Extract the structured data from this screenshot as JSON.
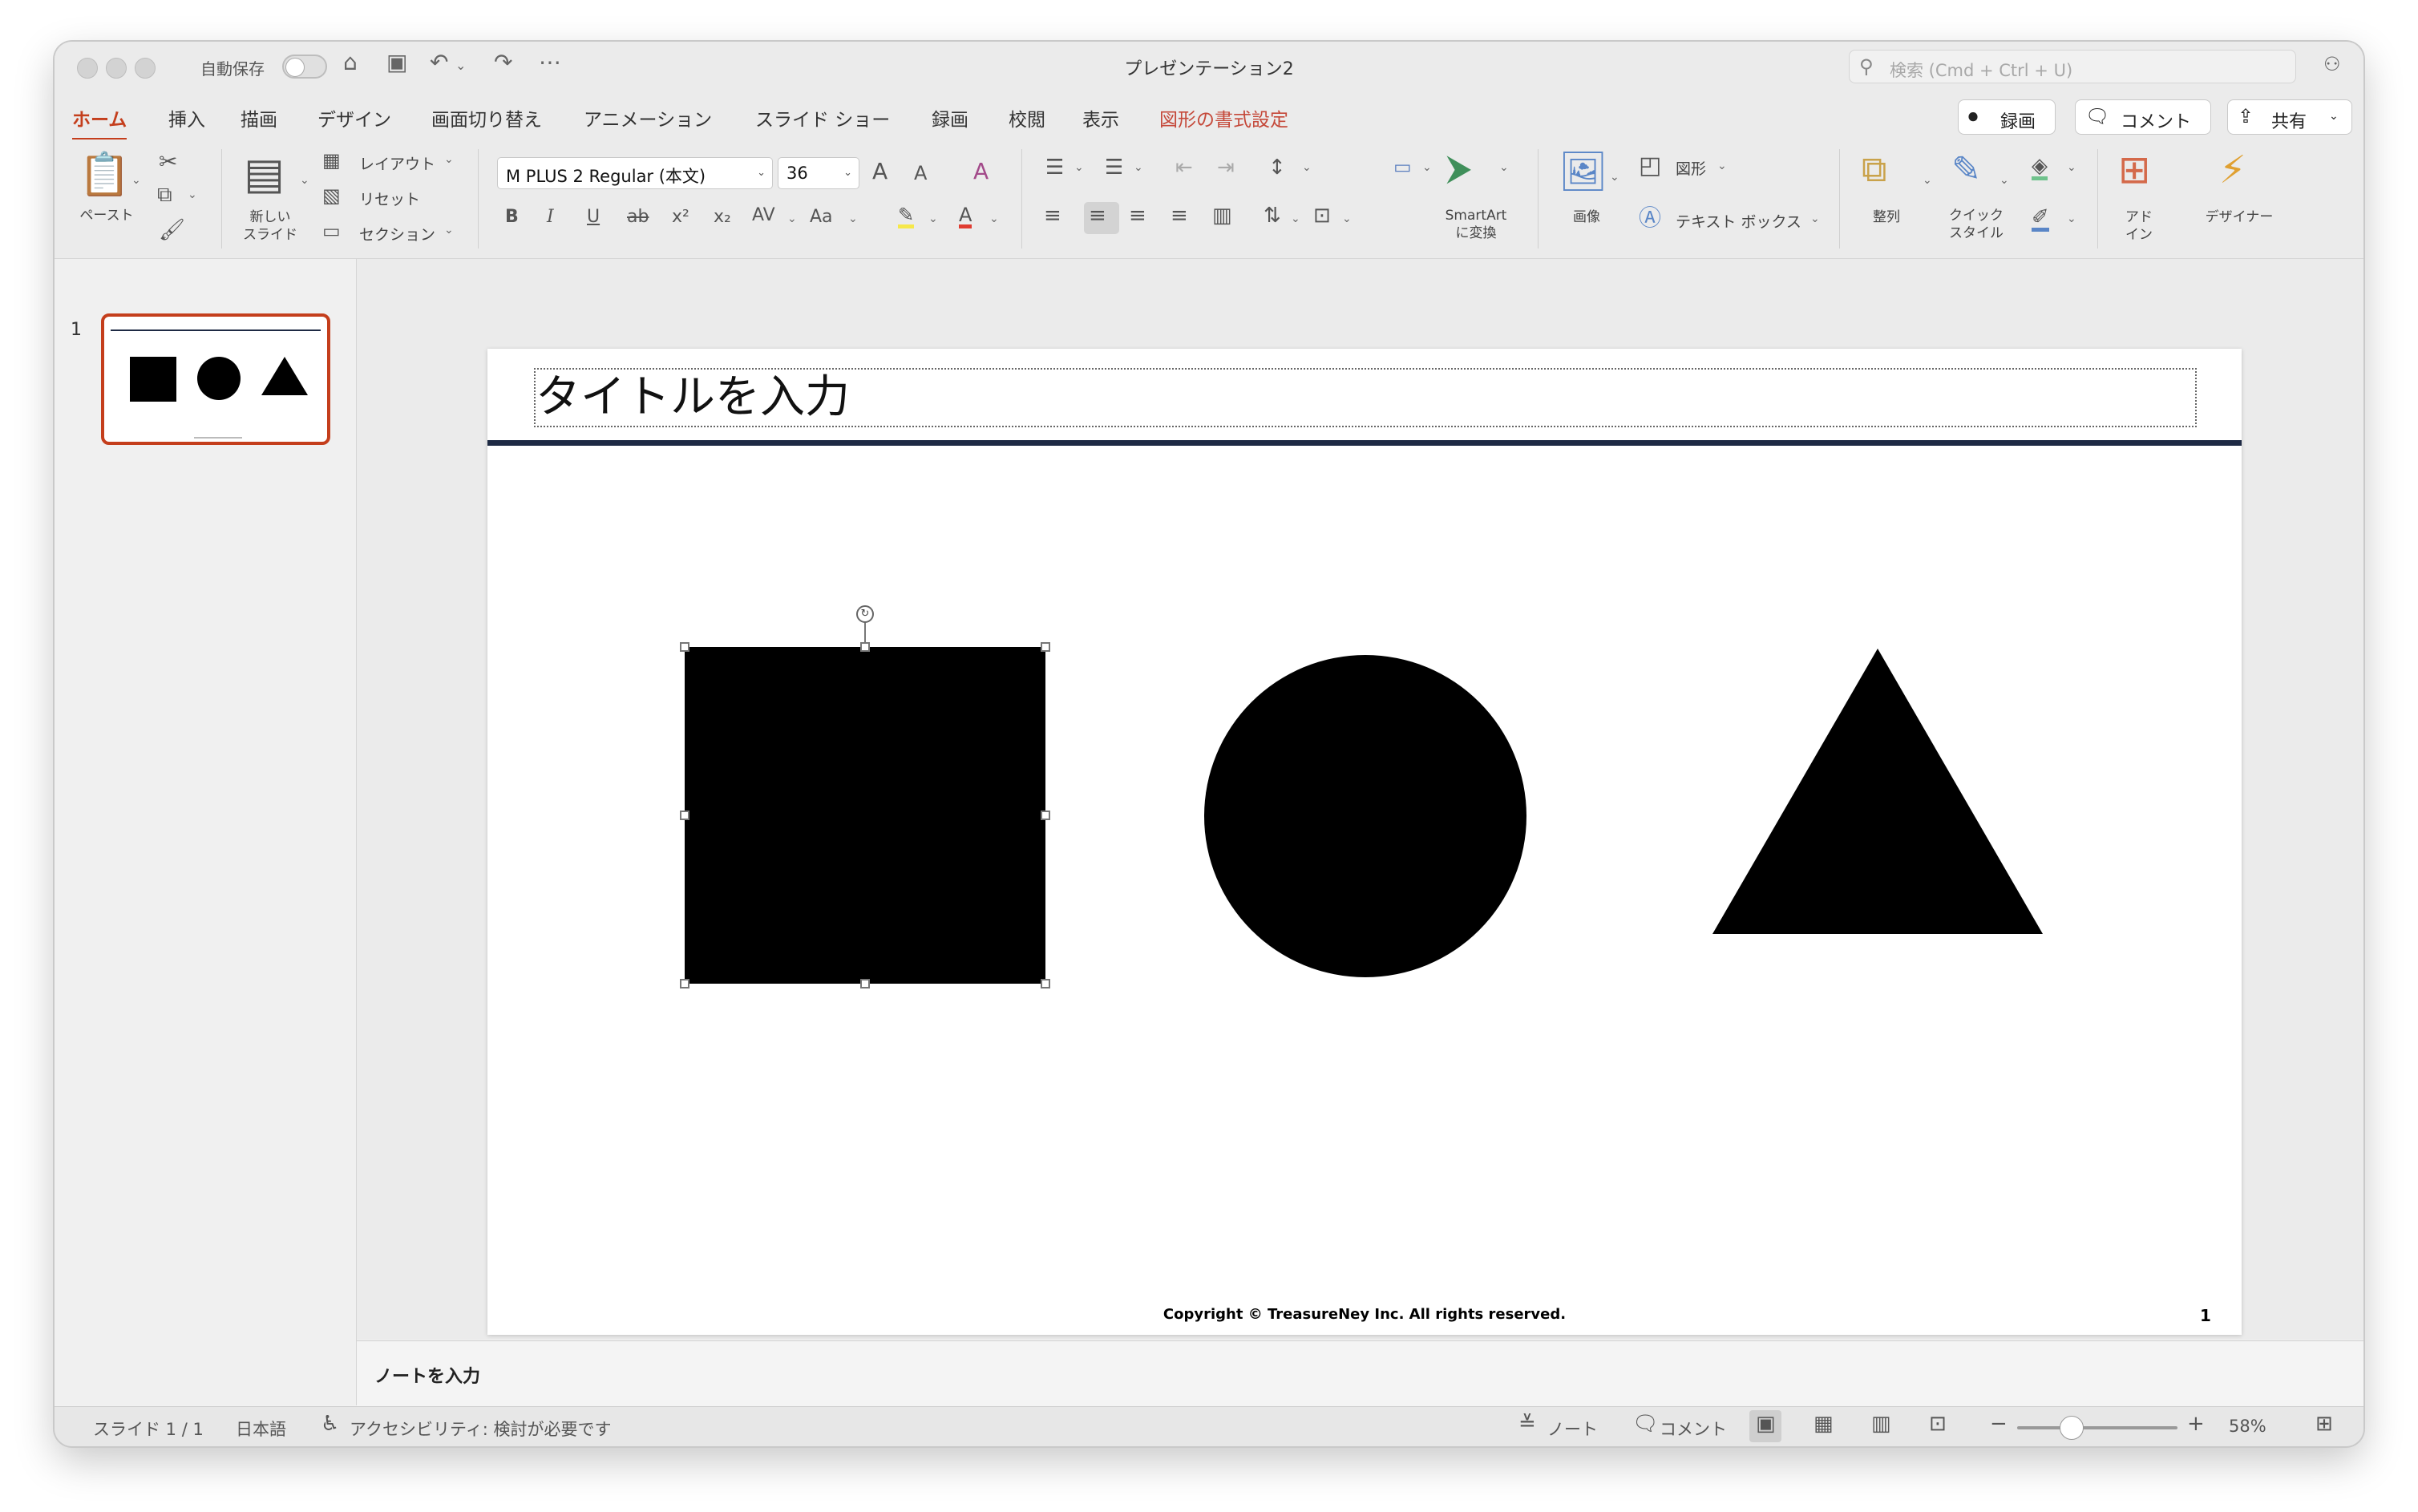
{
  "titlebar": {
    "autosave_label": "自動保存",
    "document_title": "プレゼンテーション2",
    "search_placeholder": "検索 (Cmd + Ctrl + U)"
  },
  "tabs": [
    {
      "label": "ホーム",
      "active": true
    },
    {
      "label": "挿入"
    },
    {
      "label": "描画"
    },
    {
      "label": "デザイン"
    },
    {
      "label": "画面切り替え"
    },
    {
      "label": "アニメーション"
    },
    {
      "label": "スライド ショー"
    },
    {
      "label": "録画"
    },
    {
      "label": "校閲"
    },
    {
      "label": "表示"
    },
    {
      "label": "図形の書式設定",
      "contextual": true
    }
  ],
  "actions": {
    "record": "録画",
    "comment": "コメント",
    "share": "共有"
  },
  "ribbon": {
    "paste": "ペースト",
    "new_slide": "新しい\nスライド",
    "layout": "レイアウト",
    "reset": "リセット",
    "section": "セクション",
    "font_name": "M PLUS 2 Regular (本文)",
    "font_size": "36",
    "smartart": "SmartArt\nに変換",
    "image": "画像",
    "shapes": "図形",
    "textbox": "テキスト ボックス",
    "arrange": "整列",
    "quick_style": "クイック\nスタイル",
    "addins": "アド\nイン",
    "designer": "デザイナー"
  },
  "thumbnail": {
    "number": "1"
  },
  "slide": {
    "title_placeholder": "タイトルを入力",
    "copyright": "Copyright © TreasureNey Inc. All rights reserved.",
    "page_number": "1"
  },
  "notes": {
    "placeholder": "ノートを入力"
  },
  "statusbar": {
    "slide_indicator": "スライド 1 / 1",
    "language": "日本語",
    "accessibility": "アクセシビリティ: 検討が必要です",
    "notes": "ノート",
    "comments": "コメント",
    "zoom": "58%"
  },
  "colors": {
    "accent": "#c43e1c",
    "title_rule": "#1e2a44"
  }
}
